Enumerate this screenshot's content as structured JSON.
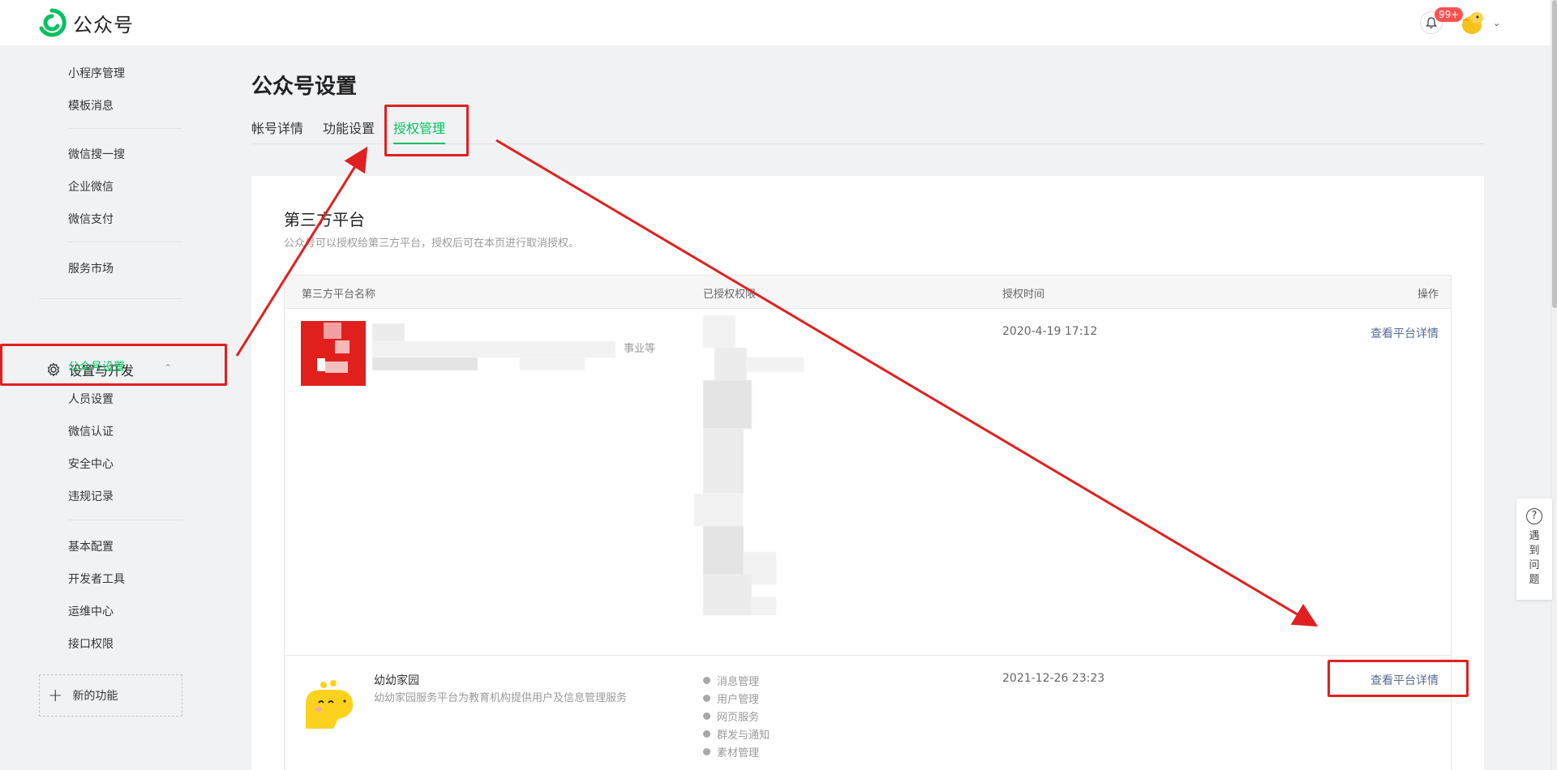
{
  "header": {
    "logo_text": "公众号",
    "notification_badge": "99+"
  },
  "sidebar": {
    "group1": [
      "小程序管理",
      "模板消息"
    ],
    "group2": [
      "微信搜一搜",
      "企业微信",
      "微信支付"
    ],
    "group3": [
      "服务市场"
    ],
    "section_title": "设置与开发",
    "group4": [
      "公众号设置",
      "人员设置",
      "微信认证",
      "安全中心",
      "违规记录"
    ],
    "group5": [
      "基本配置",
      "开发者工具",
      "运维中心",
      "接口权限"
    ],
    "new_feature": "新的功能"
  },
  "main": {
    "title": "公众号设置",
    "tabs": [
      {
        "label": "帐号详情",
        "active": false
      },
      {
        "label": "功能设置",
        "active": false
      },
      {
        "label": "授权管理",
        "active": true
      }
    ]
  },
  "card": {
    "title": "第三方平台",
    "description": "公众号可以授权给第三方平台，授权后可在本页进行取消授权。",
    "columns": [
      "第三方平台名称",
      "已授权权限",
      "授权时间",
      "操作"
    ],
    "rows": [
      {
        "name": "",
        "desc_fragment": "事业等",
        "time": "2020-4-19 17:12",
        "action": "查看平台详情"
      },
      {
        "name": "幼幼家园",
        "desc": "幼幼家园服务平台为教育机构提供用户及信息管理服务",
        "permissions": [
          "消息管理",
          "用户管理",
          "网页服务",
          "群发与通知",
          "素材管理"
        ],
        "time": "2021-12-26 23:23",
        "action": "查看平台详情"
      }
    ]
  },
  "help": {
    "text": "遇到问题"
  },
  "colors": {
    "accent": "#07c160",
    "link": "#576b95",
    "annotation": "#e02020"
  }
}
